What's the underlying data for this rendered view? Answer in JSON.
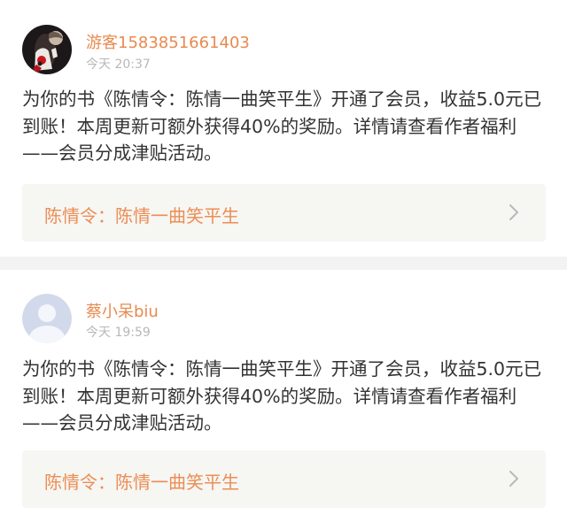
{
  "notifications": [
    {
      "username": "游客1583851661403",
      "timestamp": "今天 20:37",
      "message": "为你的书《陈情令：陈情一曲笑平生》开通了会员，收益5.0元已到账！本周更新可额外获得40%的奖励。详情请查看作者福利——会员分成津贴活动。",
      "book_title": "陈情令：陈情一曲笑平生",
      "avatar": "custom-illustration-avatar"
    },
    {
      "username": "蔡小呆biu",
      "timestamp": "今天 19:59",
      "message": "为你的书《陈情令：陈情一曲笑平生》开通了会员，收益5.0元已到账！本周更新可额外获得40%的奖励。详情请查看作者福利——会员分成津贴活动。",
      "book_title": "陈情令：陈情一曲笑平生",
      "avatar": "default-user-avatar"
    }
  ],
  "colors": {
    "username": "#e88a4f",
    "book_title": "#ec8d55",
    "timestamp": "#b8b8b8",
    "message": "#333333",
    "book_card_bg": "#f6f6f2",
    "divider": "#f3f3f3"
  },
  "icons": {
    "chevron": "chevron-right-icon"
  }
}
